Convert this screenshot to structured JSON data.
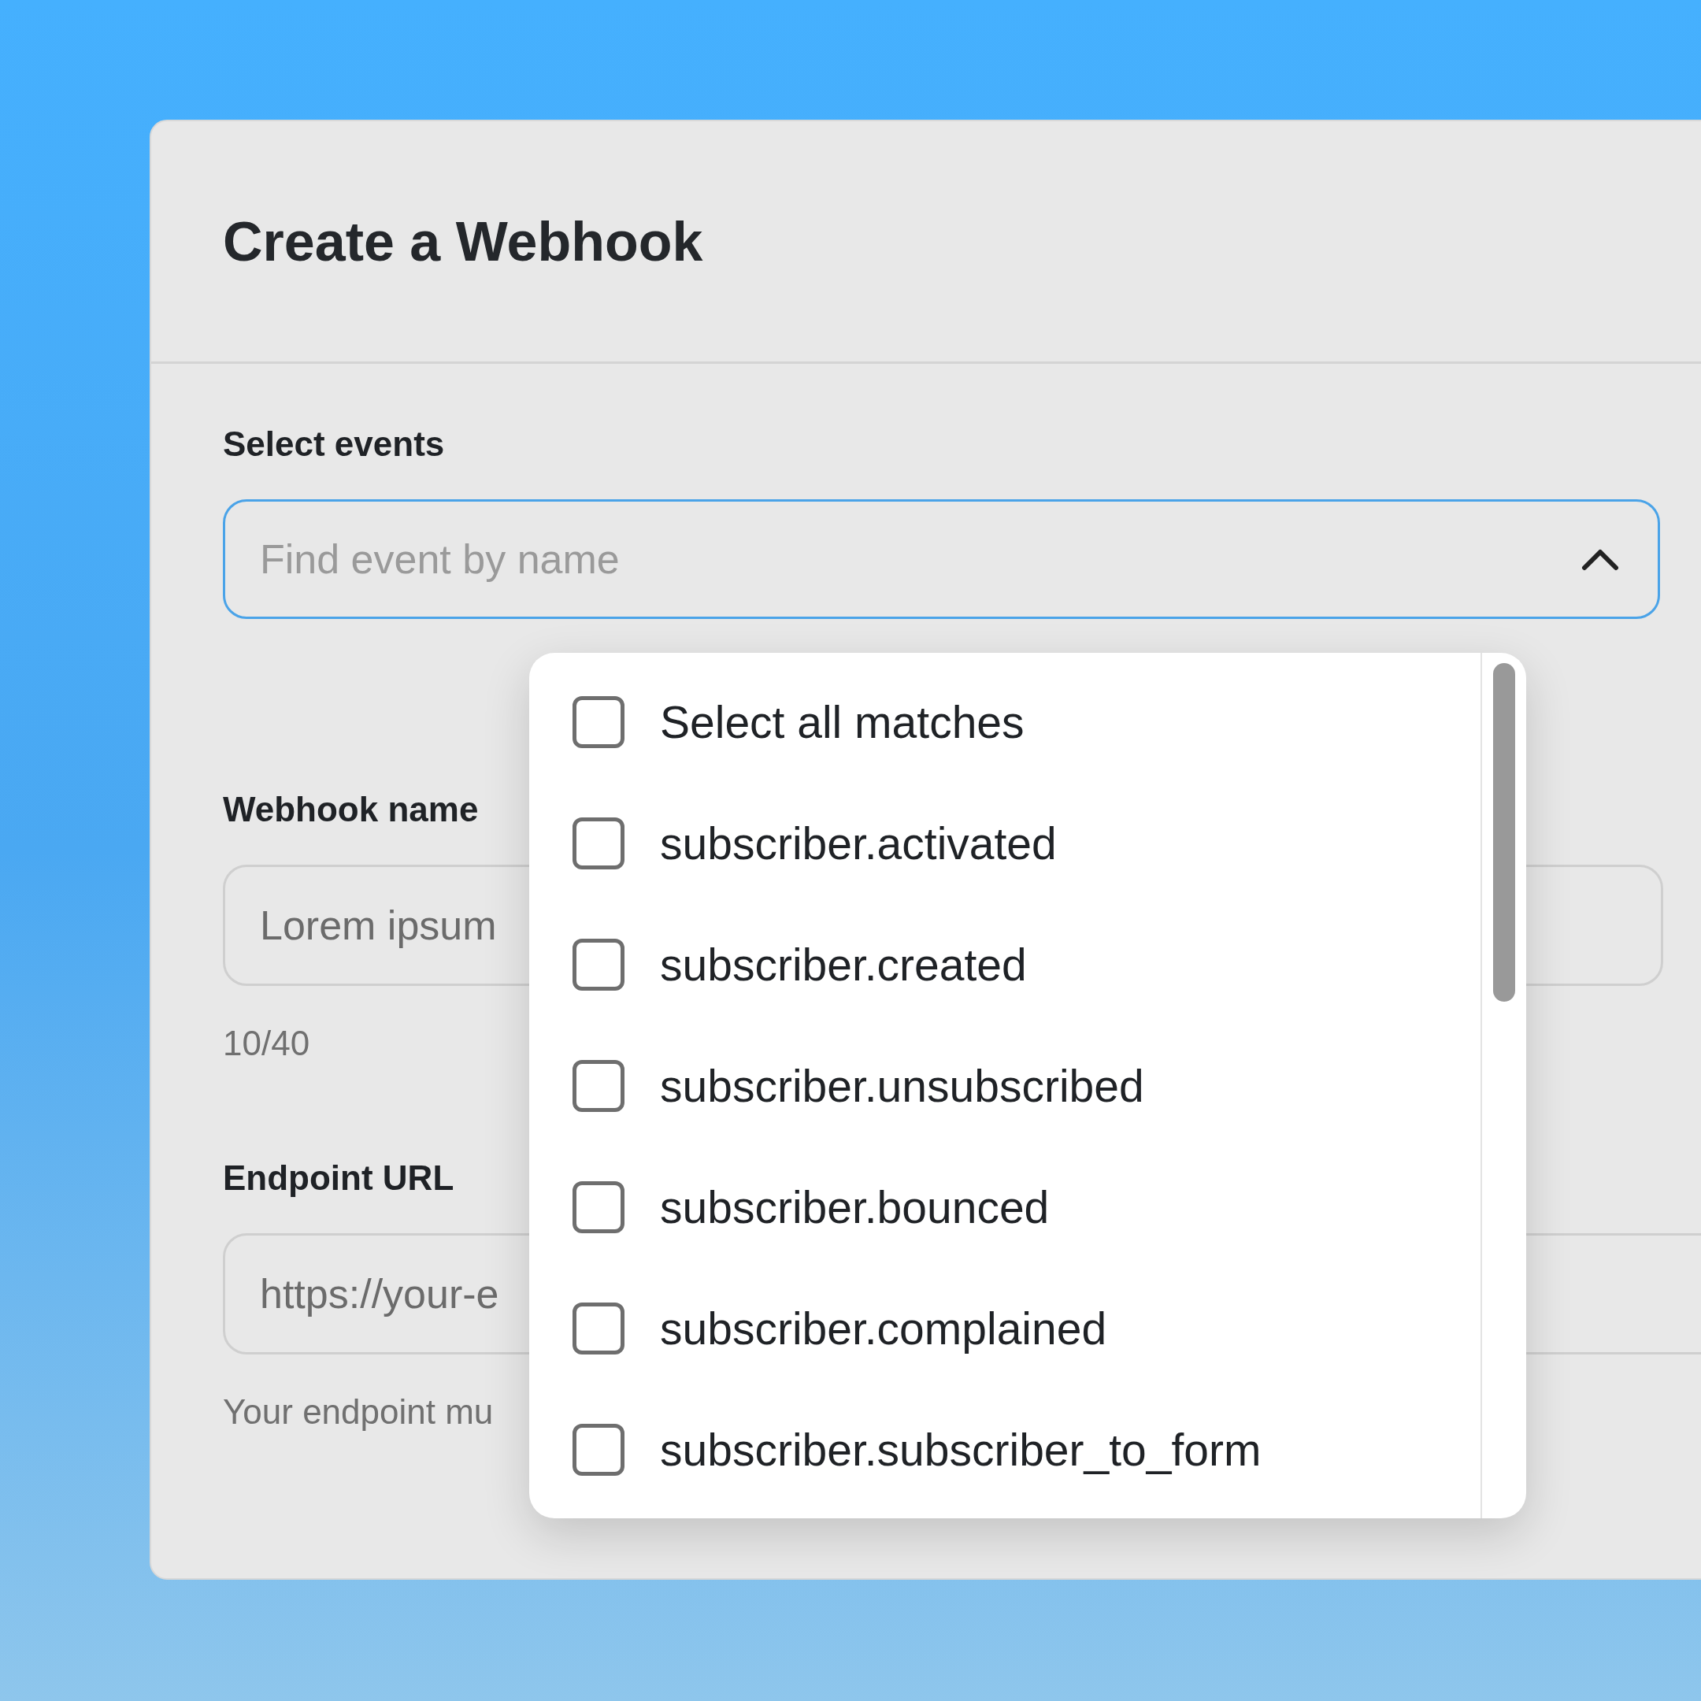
{
  "dialog": {
    "title": "Create a Webhook"
  },
  "events": {
    "label": "Select events",
    "search": {
      "placeholder": "Find event by name",
      "expanded": true
    },
    "options": [
      {
        "label": "Select all matches",
        "checked": false
      },
      {
        "label": "subscriber.activated",
        "checked": false
      },
      {
        "label": "subscriber.created",
        "checked": false
      },
      {
        "label": "subscriber.unsubscribed",
        "checked": false
      },
      {
        "label": "subscriber.bounced",
        "checked": false
      },
      {
        "label": "subscriber.complained",
        "checked": false
      },
      {
        "label": "subscriber.subscriber_to_form",
        "checked": false
      }
    ]
  },
  "webhook_name": {
    "label": "Webhook name",
    "value": "Lorem ipsum",
    "counter": "10/40"
  },
  "endpoint_url": {
    "label": "Endpoint URL",
    "value": "https://your-e",
    "helper": "Your endpoint mu"
  }
}
